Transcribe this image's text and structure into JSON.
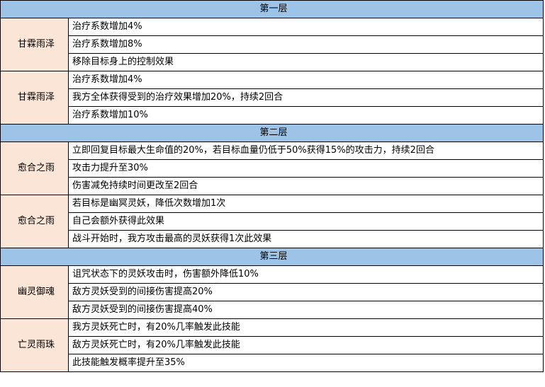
{
  "colors": {
    "tier_header_bg": "#9dc3e6",
    "skill_name_bg": "#fbe5d6",
    "effect_bg": "#ffffff",
    "border": "#000000"
  },
  "tiers": [
    {
      "title": "第一层",
      "skills": [
        {
          "name": "甘霖雨泽",
          "effects": [
            "治疗系数增加4%",
            "治疗系数增加8%",
            "移除目标身上的控制效果"
          ]
        },
        {
          "name": "甘霖雨泽",
          "effects": [
            "治疗系数增加4%",
            "我方全体获得受到的治疗效果增加20%，持续2回合",
            "治疗系数增加10%"
          ]
        }
      ]
    },
    {
      "title": "第二层",
      "skills": [
        {
          "name": "愈合之雨",
          "effects": [
            "立即回复目标最大生命值的20%，若目标血量仍低于50%获得15%的攻击力，持续2回合",
            "攻击力提升至30%",
            "伤害减免持续时间更改至2回合"
          ]
        },
        {
          "name": "愈合之雨",
          "effects": [
            "若目标是幽冥灵妖，降低次数增加1次",
            "自己会额外获得此效果",
            "战斗开始时，我方攻击最高的灵妖获得1次此效果"
          ]
        }
      ]
    },
    {
      "title": "第三层",
      "skills": [
        {
          "name": "幽灵御魂",
          "effects": [
            "诅咒状态下的灵妖攻击时，伤害额外降低10%",
            "敌方灵妖受到的间接伤害提高20%",
            "敌方灵妖受到的间接伤害提高40%"
          ]
        },
        {
          "name": "亡灵雨珠",
          "effects": [
            "我方灵妖死亡时，有20%几率触发此技能",
            "敌方灵妖死亡时，有20%几率触发此技能",
            "此技能触发概率提升至35%"
          ]
        }
      ]
    }
  ]
}
